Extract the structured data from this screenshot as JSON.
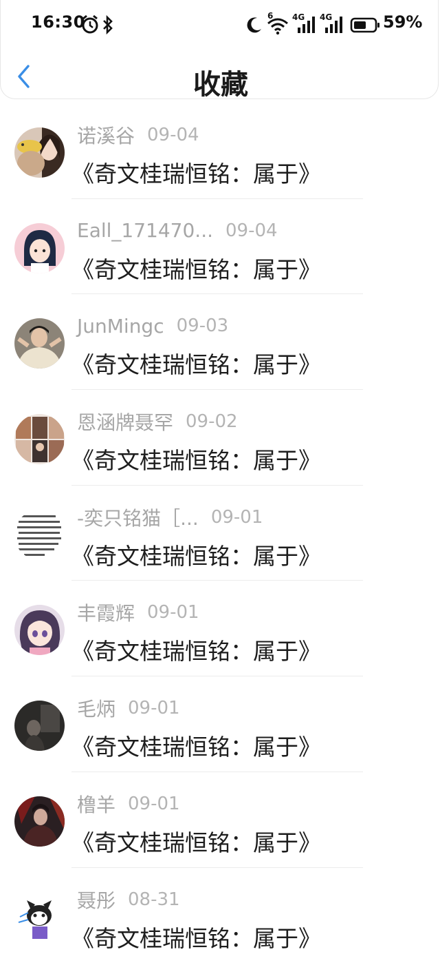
{
  "status_bar": {
    "time": "16:30",
    "battery": "59%",
    "network_1": "4G",
    "network_2": "4G",
    "wifi_badge": "6"
  },
  "header": {
    "title": "收藏"
  },
  "items": [
    {
      "user": "诺溪谷",
      "date": "09-04",
      "title": "《奇文桂瑞恒铭：属于》",
      "avatar": "photo-girl-with-toy"
    },
    {
      "user": "Eall_171470...",
      "date": "09-04",
      "title": "《奇文桂瑞恒铭：属于》",
      "avatar": "cartoon-girl"
    },
    {
      "user": "JunMingc",
      "date": "09-03",
      "title": "《奇文桂瑞恒铭：属于》",
      "avatar": "photo-boy"
    },
    {
      "user": "恩涵牌聂罕",
      "date": "09-02",
      "title": "《奇文桂瑞恒铭：属于》",
      "avatar": "photo-collage"
    },
    {
      "user": "-奕只铭猫［...",
      "date": "09-01",
      "title": "《奇文桂瑞恒铭：属于》",
      "avatar": "text-image"
    },
    {
      "user": "丰霞辉",
      "date": "09-01",
      "title": "《奇文桂瑞恒铭：属于》",
      "avatar": "anime-girl"
    },
    {
      "user": "毛炳",
      "date": "09-01",
      "title": "《奇文桂瑞恒铭：属于》",
      "avatar": "dark-photo"
    },
    {
      "user": "橹羊",
      "date": "09-01",
      "title": "《奇文桂瑞恒铭：属于》",
      "avatar": "red-dark-art"
    },
    {
      "user": "聂彤",
      "date": "08-31",
      "title": "《奇文桂瑞恒铭：属于》",
      "avatar": "cartoon-cat"
    }
  ],
  "colors": {
    "accent": "#3a8ee6",
    "username": "#a6a6a6",
    "title_text": "#1d1d1d"
  }
}
